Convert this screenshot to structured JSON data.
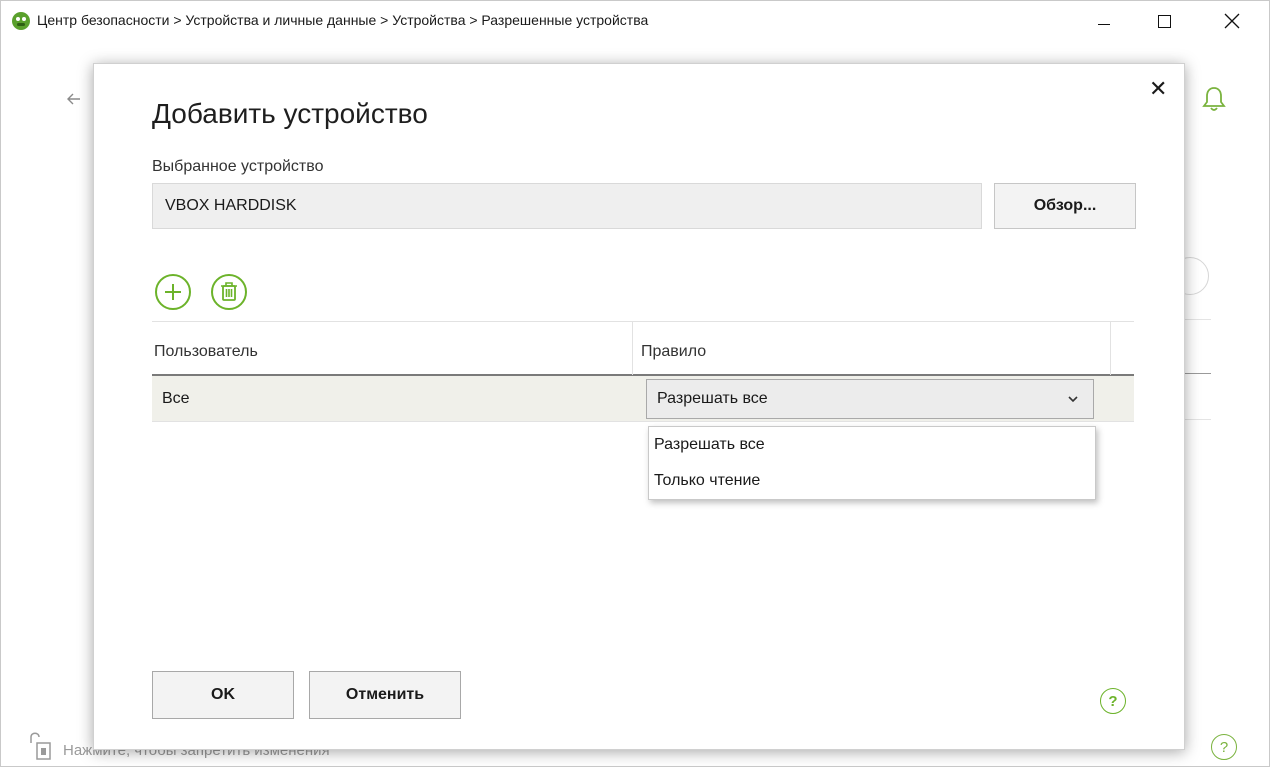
{
  "window": {
    "title": "Центр безопасности > Устройства и личные данные > Устройства > Разрешенные устройства"
  },
  "background": {
    "lock_hint": "Нажмите, чтобы запретить изменения",
    "help_glyph": "?"
  },
  "dialog": {
    "title": "Добавить устройство",
    "close_glyph": "✕",
    "device_label": "Выбранное устройство",
    "device_value": "VBOX HARDDISK",
    "browse_label": "Обзор...",
    "table": {
      "columns": [
        "Пользователь",
        "Правило"
      ],
      "rows": [
        {
          "user": "Все",
          "rule": "Разрешать все"
        }
      ]
    },
    "rule_options": [
      "Разрешать все",
      "Только чтение"
    ],
    "ok_label": "OK",
    "cancel_label": "Отменить",
    "help_glyph": "?"
  },
  "colors": {
    "accent_green": "#6cb32a",
    "selected_row": "#f0f0ea"
  }
}
